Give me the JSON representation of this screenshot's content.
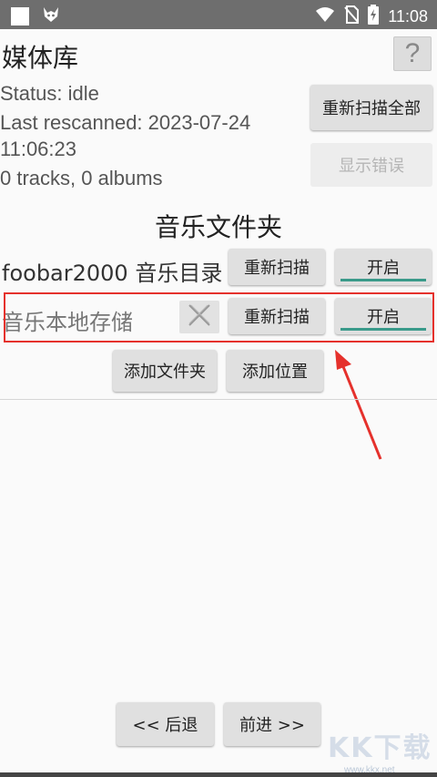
{
  "statusbar": {
    "time": "11:08",
    "icons": [
      "square-notification-icon",
      "fox-app-icon",
      "wifi-icon",
      "no-sim-icon",
      "battery-charging-icon"
    ]
  },
  "header": {
    "title": "媒体库",
    "help_label": "?"
  },
  "status": {
    "status_line": "Status: idle",
    "rescanned_line1": "Last rescanned: 2023-07-24",
    "rescanned_line2": "11:06:23",
    "counts": "0 tracks, 0 albums"
  },
  "actions": {
    "rescan_all_label": "重新扫描全部",
    "show_errors_label": "显示错误"
  },
  "music_folders": {
    "section_title": "音乐文件夹",
    "items": [
      {
        "label": "foobar2000 音乐目录",
        "rescan_label": "重新扫描",
        "toggle_label": "开启"
      },
      {
        "label": "音乐本地存储",
        "rescan_label": "重新扫描",
        "toggle_label": "开启"
      }
    ],
    "add_folder_label": "添加文件夹",
    "add_location_label": "添加位置"
  },
  "navigation": {
    "back_label": "<< 后退",
    "forward_label": "前进 >>"
  },
  "watermark": {
    "text": "KK下载",
    "url": "www.kkx.net"
  },
  "colors": {
    "highlight": "#e5312c",
    "toggle_accent": "#3a9a8a",
    "statusbar": "#6e6e6e"
  }
}
